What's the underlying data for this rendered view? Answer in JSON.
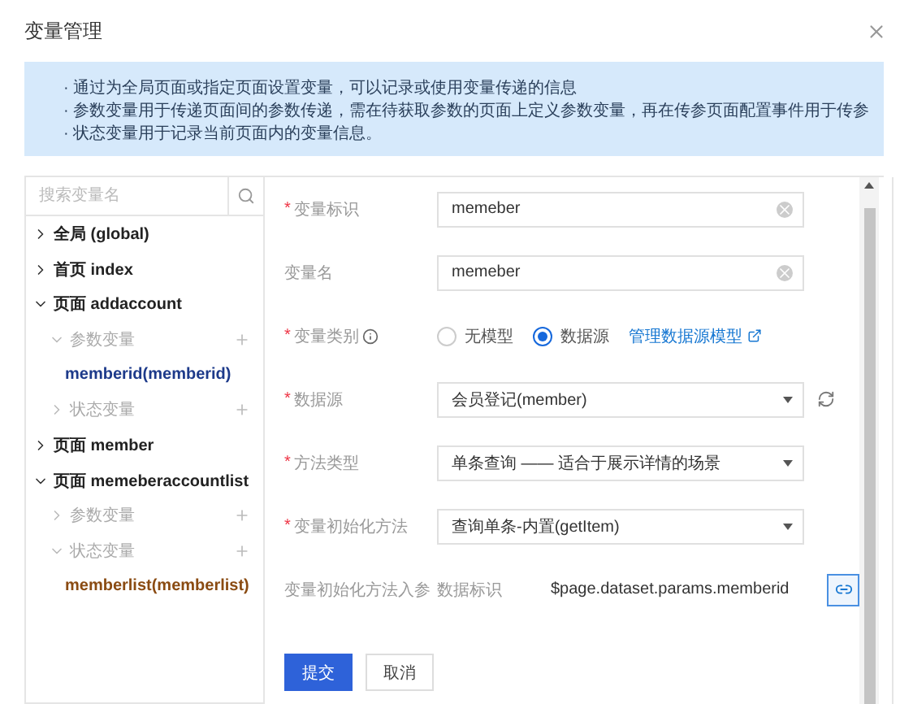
{
  "dialog": {
    "title": "变量管理"
  },
  "notice": {
    "lines": [
      "· 通过为全局页面或指定页面设置变量，可以记录或使用变量传递的信息",
      "· 参数变量用于传递页面间的参数传递，需在待获取参数的页面上定义参数变量，再在传参页面配置事件用于传参",
      "· 状态变量用于记录当前页面内的变量信息。"
    ]
  },
  "search": {
    "placeholder": "搜索变量名"
  },
  "tree": [
    {
      "kind": "page",
      "prefix": "全局",
      "label": "(global)",
      "expanded": false
    },
    {
      "kind": "page",
      "prefix": "首页",
      "label": "index",
      "expanded": false
    },
    {
      "kind": "page",
      "prefix": "页面",
      "label": "addaccount",
      "expanded": true,
      "children": [
        {
          "kind": "group",
          "label": "参数变量",
          "expanded": true,
          "children": [
            {
              "kind": "variable",
              "label": "memberid(memberid)",
              "color": "#1d3a8a"
            }
          ]
        },
        {
          "kind": "group",
          "label": "状态变量",
          "expanded": false
        }
      ]
    },
    {
      "kind": "page",
      "prefix": "页面",
      "label": "member",
      "expanded": false
    },
    {
      "kind": "page",
      "prefix": "页面",
      "label": "memeberaccountlist",
      "expanded": true,
      "children": [
        {
          "kind": "group",
          "label": "参数变量",
          "expanded": false
        },
        {
          "kind": "group",
          "label": "状态变量",
          "expanded": true,
          "children": [
            {
              "kind": "variable",
              "label": "memberlist(memberlist)",
              "color": "#8a4b12"
            }
          ]
        }
      ]
    }
  ],
  "form": [
    {
      "kind": "input",
      "label": "变量标识",
      "required_mark": "*",
      "value": "memeber"
    },
    {
      "kind": "input",
      "label": "变量名",
      "value": "memeber"
    },
    {
      "kind": "radio",
      "label": "变量类别",
      "required_mark": "*",
      "options": [
        {
          "label": "无模型",
          "selected": false
        },
        {
          "label": "数据源",
          "selected": true
        }
      ],
      "link": "管理数据源模型"
    },
    {
      "kind": "select",
      "label": "数据源",
      "required_mark": "*",
      "value": "会员登记(member)",
      "refresh": true
    },
    {
      "kind": "select",
      "label": "方法类型",
      "required_mark": "*",
      "value": "单条查询 —— 适合于展示详情的场景"
    },
    {
      "kind": "select",
      "label": "变量初始化方法",
      "required_mark": "*",
      "value": "查询单条-内置(getItem)"
    },
    {
      "kind": "param",
      "label": "变量初始化方法入参",
      "param_label": "数据标识",
      "value": "$page.dataset.params.memberid"
    }
  ],
  "buttons": [
    {
      "kind": "primary",
      "label": "提交"
    },
    {
      "kind": "default",
      "label": "取消"
    }
  ]
}
